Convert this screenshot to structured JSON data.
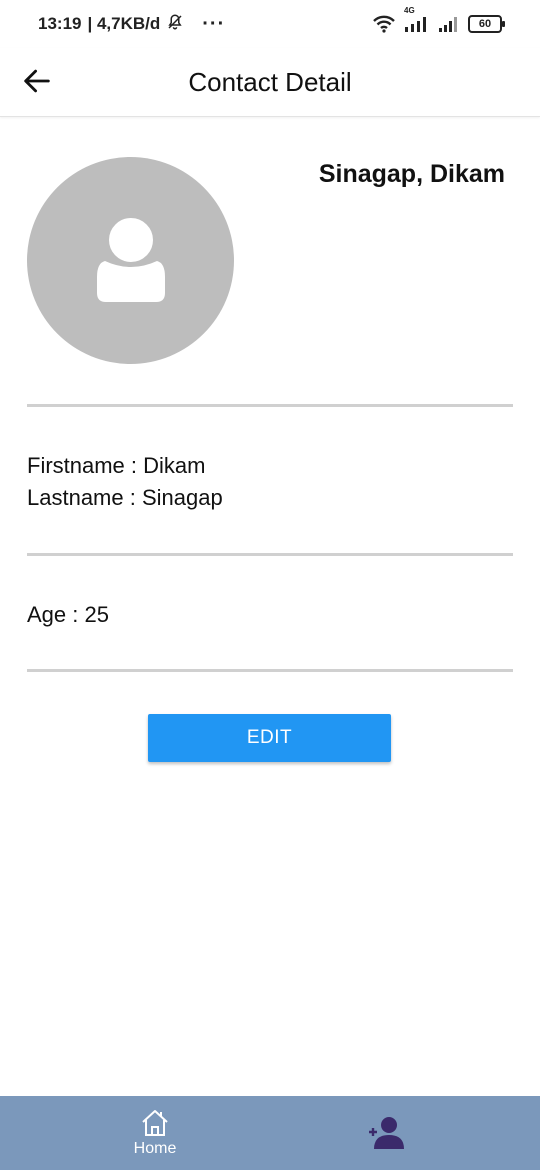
{
  "status_bar": {
    "time": "13:19",
    "speed": "| 4,7KB/d",
    "dots": "···",
    "network": "4G",
    "battery": "60"
  },
  "app_bar": {
    "title": "Contact Detail"
  },
  "contact": {
    "display_name": "Sinagap, Dikam",
    "firstname_line": "Firstname : Dikam",
    "lastname_line": "Lastname : Sinagap",
    "age_line": "Age : 25"
  },
  "actions": {
    "edit_label": "EDIT"
  },
  "bottom_nav": {
    "home_label": "Home"
  },
  "colors": {
    "primary": "#2196f3",
    "avatar_bg": "#bdbdbd",
    "nav_bg": "#7b98bb",
    "nav_active_icon": "#3b2a6b"
  },
  "icons": [
    "back-arrow-icon",
    "person-icon",
    "home-icon",
    "add-person-icon",
    "wifi-icon",
    "signal-icon",
    "muted-bell-icon"
  ]
}
